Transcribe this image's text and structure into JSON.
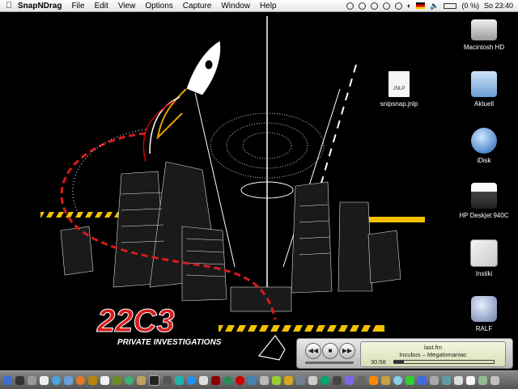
{
  "menubar": {
    "apple_icon": "apple-icon",
    "app_name": "SnapNDrag",
    "menus": [
      "File",
      "Edit",
      "View",
      "Options",
      "Capture",
      "Window",
      "Help"
    ],
    "battery_label": "(0 %)",
    "clock": "So 23:40"
  },
  "wallpaper": {
    "brand": "22C3",
    "tagline": "PRIVATE INVESTIGATIONS"
  },
  "desktop_icons": [
    {
      "label": "Macintosh HD",
      "icon": "hard-drive-icon"
    },
    {
      "label": "Aktuell",
      "icon": "folder-icon"
    },
    {
      "label": "snipsnap.jnlp",
      "icon": "document-icon",
      "badge": "JNLP"
    },
    {
      "label": "iDisk",
      "icon": "idisk-icon"
    },
    {
      "label": "HP Deskjet 940C",
      "icon": "printer-icon"
    },
    {
      "label": "Instiki",
      "icon": "app-icon"
    },
    {
      "label": "RALF",
      "icon": "disk-icon"
    }
  ],
  "itunes_mini": {
    "station": "last.fm",
    "track": "Incubus – Megalomaniac",
    "elapsed": "30:58",
    "progress": 0.1
  }
}
